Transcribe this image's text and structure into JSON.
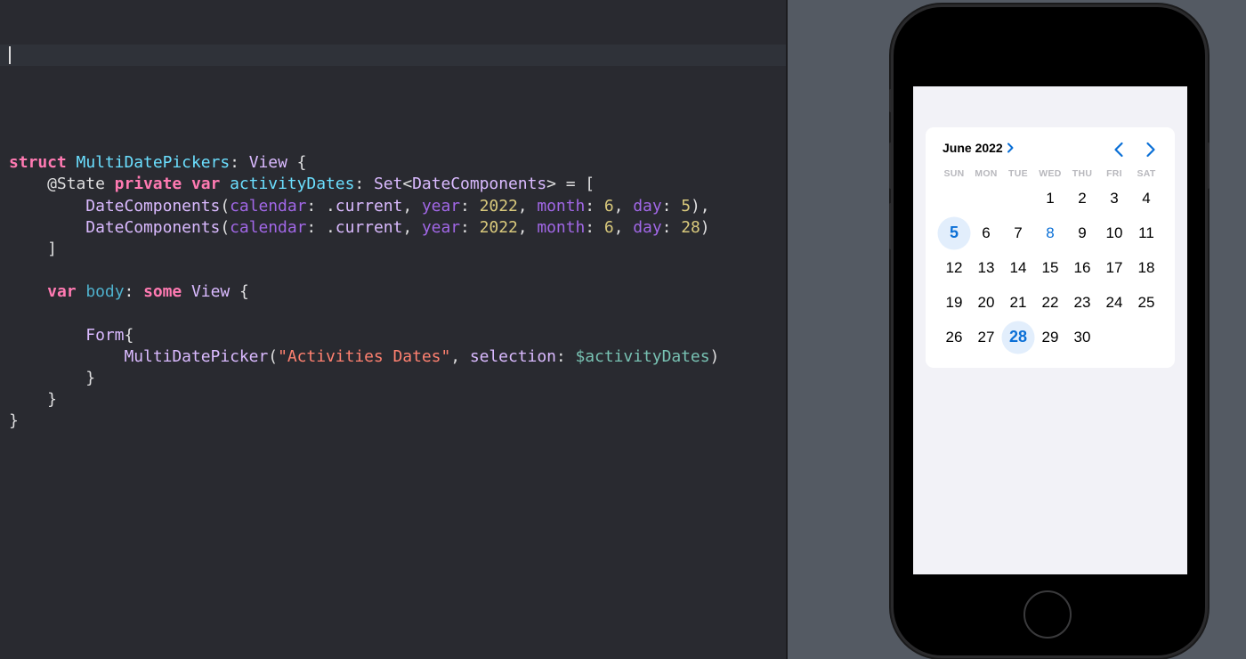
{
  "code_lines": [
    [],
    [
      {
        "t": "struct",
        "c": "keyword"
      },
      {
        "t": " ",
        "c": "plain"
      },
      {
        "t": "MultiDatePickers",
        "c": "decl"
      },
      {
        "t": ": ",
        "c": "plain"
      },
      {
        "t": "View",
        "c": "type"
      },
      {
        "t": " {",
        "c": "plain"
      }
    ],
    [
      {
        "t": "    @State ",
        "c": "plain"
      },
      {
        "t": "private",
        "c": "keyword"
      },
      {
        "t": " ",
        "c": "plain"
      },
      {
        "t": "var",
        "c": "keyword"
      },
      {
        "t": " ",
        "c": "plain"
      },
      {
        "t": "activityDates",
        "c": "decl"
      },
      {
        "t": ": ",
        "c": "plain"
      },
      {
        "t": "Set",
        "c": "type"
      },
      {
        "t": "<",
        "c": "plain"
      },
      {
        "t": "DateComponents",
        "c": "type"
      },
      {
        "t": "> = [",
        "c": "plain"
      }
    ],
    [
      {
        "t": "        ",
        "c": "plain"
      },
      {
        "t": "DateComponents",
        "c": "type"
      },
      {
        "t": "(",
        "c": "plain"
      },
      {
        "t": "calendar",
        "c": "param"
      },
      {
        "t": ": .",
        "c": "plain"
      },
      {
        "t": "current",
        "c": "type"
      },
      {
        "t": ", ",
        "c": "plain"
      },
      {
        "t": "year",
        "c": "param"
      },
      {
        "t": ": ",
        "c": "plain"
      },
      {
        "t": "2022",
        "c": "number"
      },
      {
        "t": ", ",
        "c": "plain"
      },
      {
        "t": "month",
        "c": "param"
      },
      {
        "t": ": ",
        "c": "plain"
      },
      {
        "t": "6",
        "c": "number"
      },
      {
        "t": ", ",
        "c": "plain"
      },
      {
        "t": "day",
        "c": "param"
      },
      {
        "t": ": ",
        "c": "plain"
      },
      {
        "t": "5",
        "c": "number"
      },
      {
        "t": "),",
        "c": "plain"
      }
    ],
    [
      {
        "t": "        ",
        "c": "plain"
      },
      {
        "t": "DateComponents",
        "c": "type"
      },
      {
        "t": "(",
        "c": "plain"
      },
      {
        "t": "calendar",
        "c": "param"
      },
      {
        "t": ": .",
        "c": "plain"
      },
      {
        "t": "current",
        "c": "type"
      },
      {
        "t": ", ",
        "c": "plain"
      },
      {
        "t": "year",
        "c": "param"
      },
      {
        "t": ": ",
        "c": "plain"
      },
      {
        "t": "2022",
        "c": "number"
      },
      {
        "t": ", ",
        "c": "plain"
      },
      {
        "t": "month",
        "c": "param"
      },
      {
        "t": ": ",
        "c": "plain"
      },
      {
        "t": "6",
        "c": "number"
      },
      {
        "t": ", ",
        "c": "plain"
      },
      {
        "t": "day",
        "c": "param"
      },
      {
        "t": ": ",
        "c": "plain"
      },
      {
        "t": "28",
        "c": "number"
      },
      {
        "t": ")",
        "c": "plain"
      }
    ],
    [
      {
        "t": "    ]",
        "c": "plain"
      }
    ],
    [],
    [
      {
        "t": "    ",
        "c": "plain"
      },
      {
        "t": "var",
        "c": "keyword"
      },
      {
        "t": " ",
        "c": "plain"
      },
      {
        "t": "body",
        "c": "prop"
      },
      {
        "t": ": ",
        "c": "plain"
      },
      {
        "t": "some",
        "c": "keyword"
      },
      {
        "t": " ",
        "c": "plain"
      },
      {
        "t": "View",
        "c": "type"
      },
      {
        "t": " {",
        "c": "plain"
      }
    ],
    [],
    [
      {
        "t": "        ",
        "c": "plain"
      },
      {
        "t": "Form",
        "c": "type"
      },
      {
        "t": "{",
        "c": "plain"
      }
    ],
    [
      {
        "t": "            ",
        "c": "plain"
      },
      {
        "t": "MultiDatePicker",
        "c": "type"
      },
      {
        "t": "(",
        "c": "plain"
      },
      {
        "t": "\"Activities Dates\"",
        "c": "string"
      },
      {
        "t": ", ",
        "c": "plain"
      },
      {
        "t": "selection",
        "c": "type"
      },
      {
        "t": ": ",
        "c": "plain"
      },
      {
        "t": "$activityDates",
        "c": "binding"
      },
      {
        "t": ")",
        "c": "plain"
      }
    ],
    [
      {
        "t": "        }",
        "c": "plain"
      }
    ],
    [
      {
        "t": "    }",
        "c": "plain"
      }
    ],
    [
      {
        "t": "}",
        "c": "plain"
      }
    ]
  ],
  "calendar": {
    "month_label": "June 2022",
    "weekdays": [
      "SUN",
      "MON",
      "TUE",
      "WED",
      "THU",
      "FRI",
      "SAT"
    ],
    "leading_blanks": 3,
    "days": [
      "1",
      "2",
      "3",
      "4",
      "5",
      "6",
      "7",
      "8",
      "9",
      "10",
      "11",
      "12",
      "13",
      "14",
      "15",
      "16",
      "17",
      "18",
      "19",
      "20",
      "21",
      "22",
      "23",
      "24",
      "25",
      "26",
      "27",
      "28",
      "29",
      "30"
    ],
    "selected": [
      "5",
      "28"
    ],
    "today": "8"
  },
  "colors": {
    "editor_bg": "#292a30",
    "keyword": "#ff7ab2",
    "accent": "#0a6fd6",
    "selection_circle": "#e2eefc",
    "preview_bg": "#545a63"
  }
}
